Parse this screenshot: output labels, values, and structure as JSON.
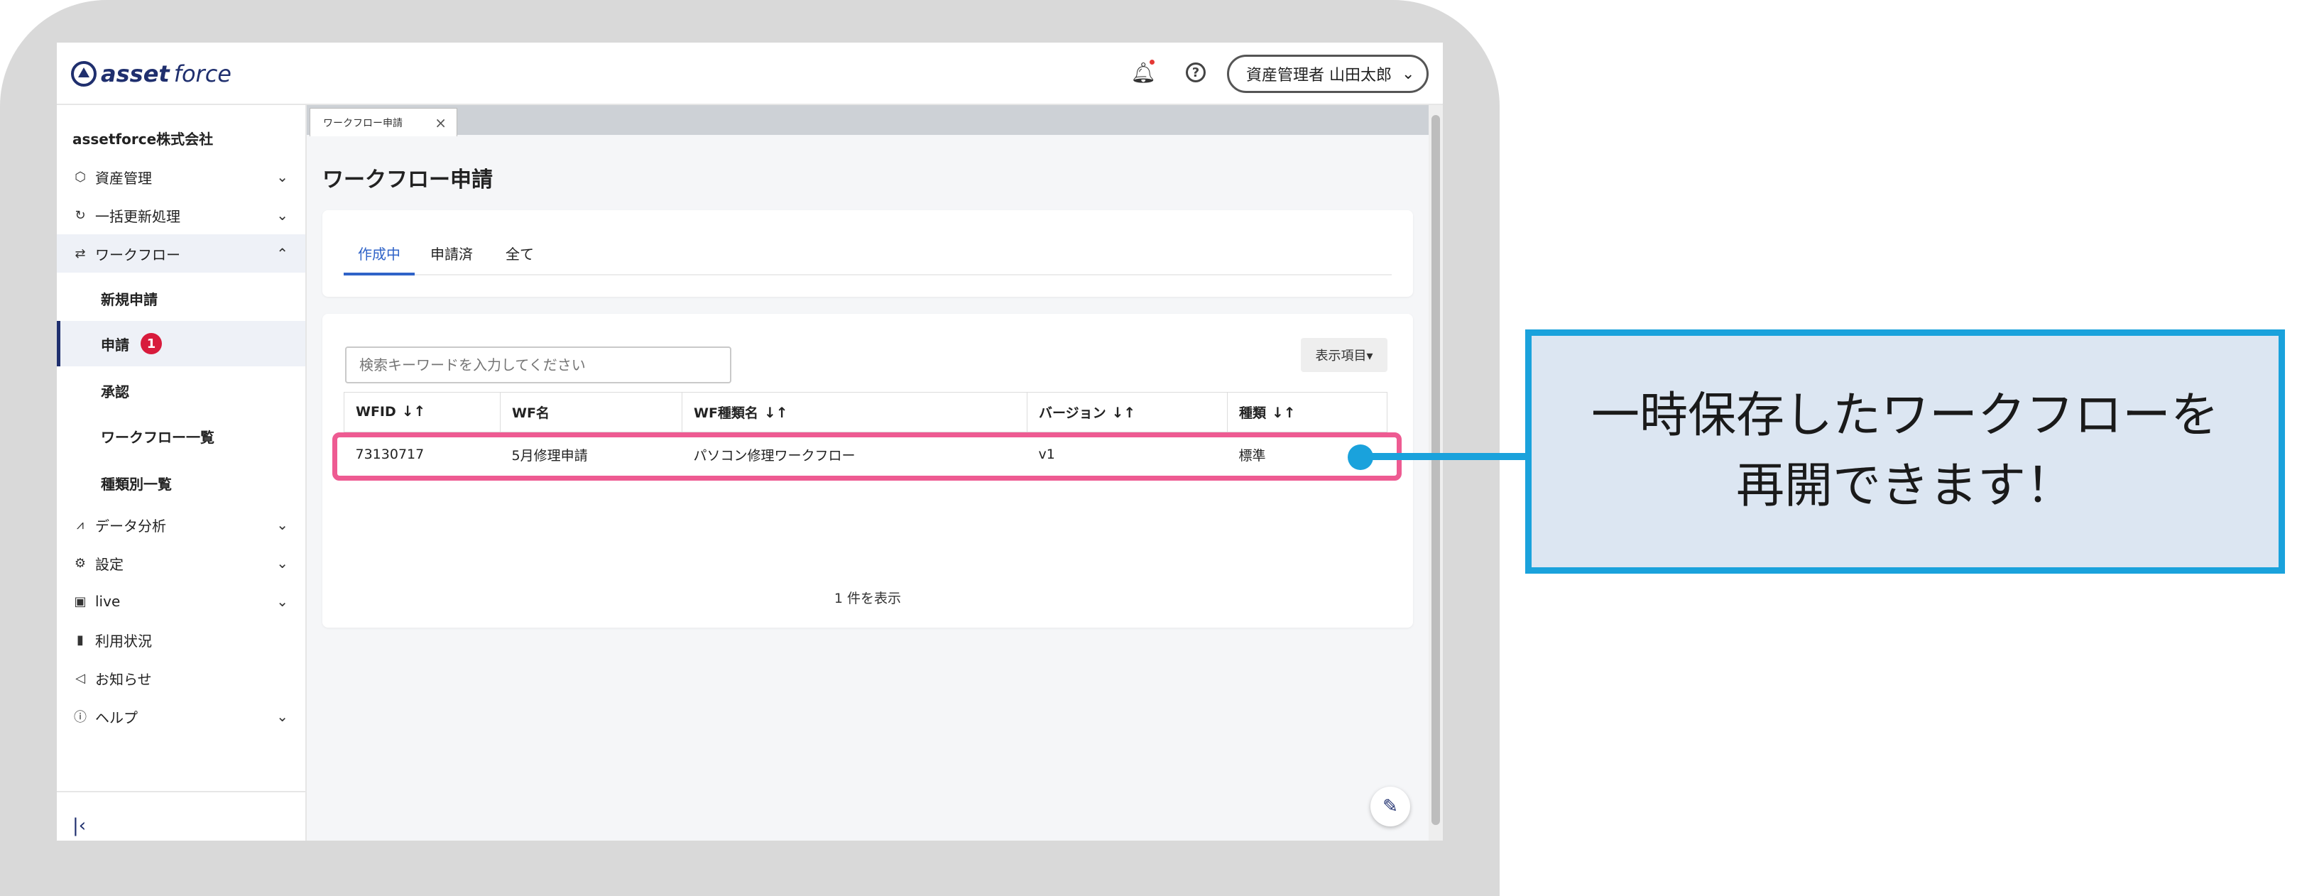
{
  "header": {
    "logo_primary": "asset",
    "logo_secondary": "force",
    "user_label": "資産管理者 山田太郎"
  },
  "sidebar": {
    "company": "assetforce株式会社",
    "items": [
      {
        "label": "資産管理",
        "icon": "cube-icon"
      },
      {
        "label": "一括更新処理",
        "icon": "refresh-icon"
      },
      {
        "label": "ワークフロー",
        "icon": "workflow-icon"
      },
      {
        "label": "データ分析",
        "icon": "analytics-icon"
      },
      {
        "label": "設定",
        "icon": "gear-icon"
      },
      {
        "label": "live",
        "icon": "live-icon"
      },
      {
        "label": "利用状況",
        "icon": "bar-chart-icon"
      },
      {
        "label": "お知らせ",
        "icon": "megaphone-icon"
      },
      {
        "label": "ヘルプ",
        "icon": "help-icon"
      }
    ],
    "workflow_sub": [
      {
        "label": "新規申請"
      },
      {
        "label": "申請",
        "badge": "1"
      },
      {
        "label": "承認"
      },
      {
        "label": "ワークフロー一覧"
      },
      {
        "label": "種類別一覧"
      }
    ]
  },
  "main": {
    "open_tab": "ワークフロー申請",
    "page_title": "ワークフロー申請",
    "tabs": [
      "作成中",
      "申請済",
      "全て"
    ],
    "search_placeholder": "検索キーワードを入力してください",
    "display_items_button": "表示項目▾",
    "columns": [
      "WFID",
      "WF名",
      "WF種類名",
      "バージョン",
      "種類"
    ],
    "rows": [
      {
        "wfid": "73130717",
        "name": "5月修理申請",
        "type_name": "パソコン修理ワークフロー",
        "version": "v1",
        "kind": "標準"
      }
    ],
    "count_text": "1 件を表示"
  },
  "callout": {
    "text": "一時保存したワークフローを\n再開できます！"
  },
  "colors": {
    "accent": "#2f63c8",
    "brand": "#1f2f6e",
    "highlight": "#ee5b92",
    "callout_border": "#1aa2dc",
    "callout_fill": "#dce6f2",
    "badge": "#d81b3c"
  }
}
